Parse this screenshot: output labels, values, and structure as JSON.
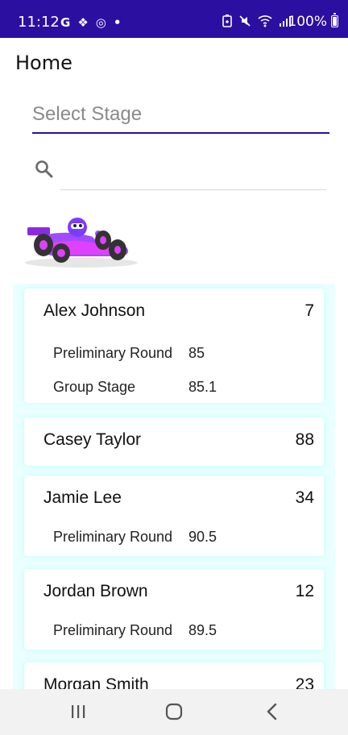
{
  "status_bar": {
    "time": "11:12",
    "left_icons": [
      "G",
      "❖",
      "◎",
      "•"
    ],
    "battery_pct": "100%"
  },
  "header": {
    "title": "Home"
  },
  "stage_picker": {
    "placeholder": "Select Stage"
  },
  "search": {
    "placeholder": ""
  },
  "players": [
    {
      "name": "Alex Johnson",
      "score": "7",
      "rounds": [
        {
          "label": "Preliminary Round",
          "value": "85"
        },
        {
          "label": "Group Stage",
          "value": "85.1"
        }
      ]
    },
    {
      "name": "Casey Taylor",
      "score": "88",
      "rounds": []
    },
    {
      "name": "Jamie Lee",
      "score": "34",
      "rounds": [
        {
          "label": "Preliminary Round",
          "value": "90.5"
        }
      ]
    },
    {
      "name": "Jordan Brown",
      "score": "12",
      "rounds": [
        {
          "label": "Preliminary Round",
          "value": "89.5"
        }
      ]
    },
    {
      "name": "Morgan Smith",
      "score": "23",
      "rounds": []
    }
  ],
  "colors": {
    "accent": "#2a0fa0",
    "list_background": "#eaffff",
    "card": "#ffffff"
  }
}
